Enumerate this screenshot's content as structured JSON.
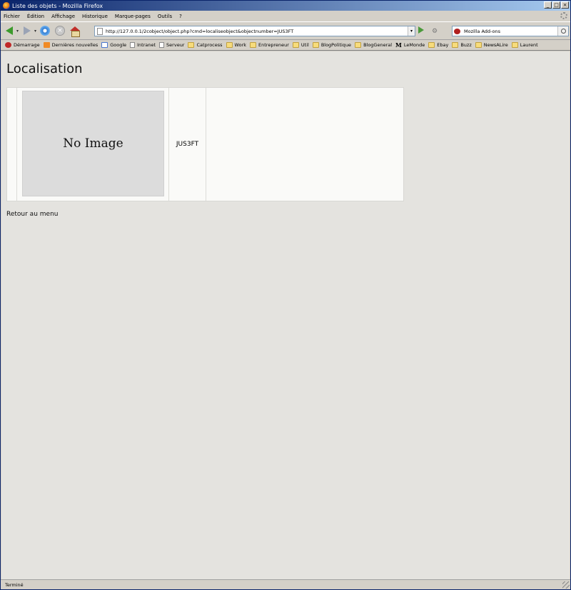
{
  "window": {
    "title": "Liste des objets - Mozilla Firefox",
    "minimize": "_",
    "maximize": "□",
    "close": "×"
  },
  "menubar": {
    "items": [
      "Fichier",
      "Édition",
      "Affichage",
      "Historique",
      "Marque-pages",
      "Outils",
      "?"
    ]
  },
  "navbar": {
    "url": "http://127.0.0.1/2cobject/object.php?cmd=localiseobject&objectnumber=JUS3FT",
    "search_value": "Mozilla Add-ons"
  },
  "bookmarks": [
    {
      "label": "Démarrage",
      "icon": "red"
    },
    {
      "label": "Dernières nouvelles",
      "icon": "rss"
    },
    {
      "label": "Google",
      "icon": "google"
    },
    {
      "label": "Intranet",
      "icon": "page"
    },
    {
      "label": "Serveur",
      "icon": "page"
    },
    {
      "label": "Catprocess",
      "icon": "folder"
    },
    {
      "label": "Work",
      "icon": "folder"
    },
    {
      "label": "Entrepreneur",
      "icon": "folder"
    },
    {
      "label": "Util",
      "icon": "folder"
    },
    {
      "label": "BlogPolitique",
      "icon": "folder"
    },
    {
      "label": "BlogGeneral",
      "icon": "folder"
    },
    {
      "label": "LeMonde",
      "icon": "lemonde"
    },
    {
      "label": "Ebay",
      "icon": "folder"
    },
    {
      "label": "Buzz",
      "icon": "folder"
    },
    {
      "label": "NewsALire",
      "icon": "folder"
    },
    {
      "label": "Laurent",
      "icon": "folder"
    }
  ],
  "page": {
    "heading": "Localisation",
    "no_image_text": "No Image",
    "object_number": "JUS3FT",
    "back_link": "Retour au menu"
  },
  "statusbar": {
    "text": "Terminé"
  }
}
